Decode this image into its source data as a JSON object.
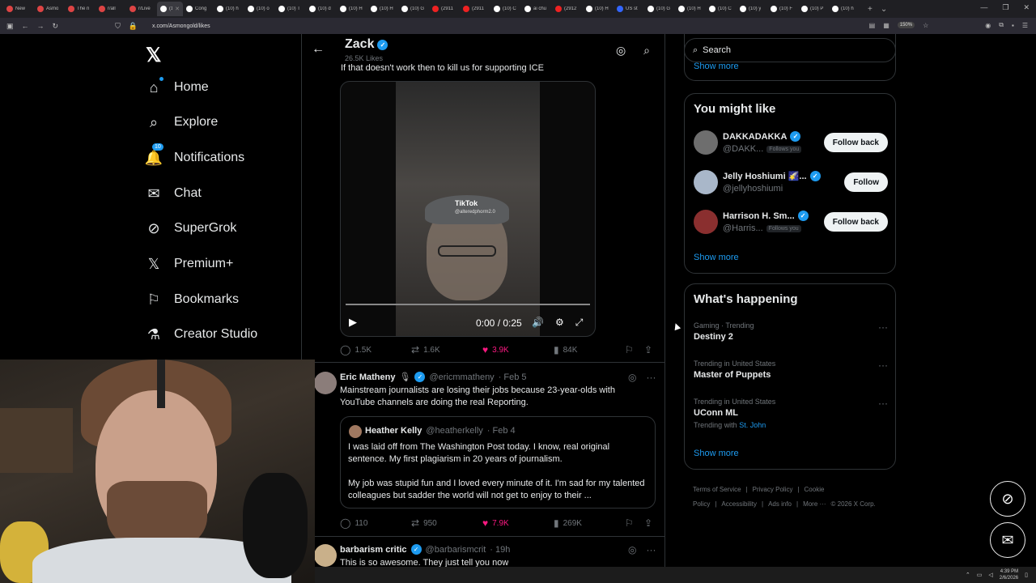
{
  "browser": {
    "tabs": [
      {
        "label": "New",
        "color": "#d44"
      },
      {
        "label": "Asmo",
        "color": "#d44"
      },
      {
        "label": "The n",
        "color": "#d44"
      },
      {
        "label": "r/all",
        "color": "#d44"
      },
      {
        "label": "r/Live",
        "color": "#d44"
      },
      {
        "label": "(1(",
        "color": "#fff"
      },
      {
        "label": "Cong",
        "color": "#fff"
      },
      {
        "label": "(10) h",
        "color": "#fff"
      },
      {
        "label": "(10) o",
        "color": "#fff"
      },
      {
        "label": "(10) T",
        "color": "#fff"
      },
      {
        "label": "(10) d",
        "color": "#fff"
      },
      {
        "label": "(10) H",
        "color": "#fff"
      },
      {
        "label": "(10) H",
        "color": "#fff"
      },
      {
        "label": "(10) G",
        "color": "#fff"
      },
      {
        "label": "(2911",
        "color": "#e22"
      },
      {
        "label": "(2911",
        "color": "#e22"
      },
      {
        "label": "(10) C",
        "color": "#fff"
      },
      {
        "label": "ai chu",
        "color": "#fff"
      },
      {
        "label": "(2912",
        "color": "#e22"
      },
      {
        "label": "(10) H",
        "color": "#fff"
      },
      {
        "label": "US st",
        "color": "#36f"
      },
      {
        "label": "(10) G",
        "color": "#fff"
      },
      {
        "label": "(10) H",
        "color": "#fff"
      },
      {
        "label": "(10) C",
        "color": "#fff"
      },
      {
        "label": "(10) y",
        "color": "#fff"
      },
      {
        "label": "(10) F",
        "color": "#fff"
      },
      {
        "label": "(10) P",
        "color": "#fff"
      },
      {
        "label": "(10) h",
        "color": "#fff"
      }
    ],
    "url": "x.com/Asmongold/likes",
    "zoom": "150%"
  },
  "nav": {
    "items": [
      {
        "label": "Home",
        "icon": "home-icon"
      },
      {
        "label": "Explore",
        "icon": "search-icon"
      },
      {
        "label": "Notifications",
        "icon": "bell-icon",
        "badge": "10"
      },
      {
        "label": "Chat",
        "icon": "mail-icon"
      },
      {
        "label": "SuperGrok",
        "icon": "grok-icon"
      },
      {
        "label": "Premium+",
        "icon": "x-icon"
      },
      {
        "label": "Bookmarks",
        "icon": "bookmark-icon"
      },
      {
        "label": "Creator Studio",
        "icon": "flask-icon"
      }
    ]
  },
  "header": {
    "name": "Zack",
    "likes": "26.5K Likes"
  },
  "tweet1": {
    "text": "If that doesn't work then to kill us for supporting ICE",
    "video": {
      "watermark": "TikTok",
      "watermark_handle": "@alteredphorm2.0",
      "time": "0:00 / 0:25",
      "progress": 0.0
    },
    "replies": "1.5K",
    "reposts": "1.6K",
    "likes": "3.9K",
    "views": "84K"
  },
  "tweet2": {
    "name": "Eric Matheny",
    "handle": "@ericmmatheny",
    "date": "· Feb 5",
    "text": "Mainstream journalists are losing their jobs because 23-year-olds with YouTube channels are doing the real Reporting.",
    "quote": {
      "name": "Heather Kelly",
      "handle": "@heatherkelly",
      "date": "· Feb 4",
      "text1": "I was laid off from The Washington Post today. I know, real original sentence. My first plagiarism in 20 years of journalism.",
      "text2": "My job was stupid fun and I loved every minute of it. I'm sad for my talented colleagues but sadder the world will not get to enjoy to their ..."
    },
    "replies": "110",
    "reposts": "950",
    "likes": "7.9K",
    "views": "269K"
  },
  "tweet3": {
    "name": "barbarism critic",
    "handle": "@barbarismcrit",
    "date": "· 19h",
    "text": "This is so awesome. They just tell you now"
  },
  "search": {
    "placeholder": "Search"
  },
  "top_card": {
    "show_more": "Show more"
  },
  "you_might_like": {
    "title": "You might like",
    "people": [
      {
        "name": "DAKKADAKKA",
        "handle": "@DAKK...",
        "follows_you": "Follows you",
        "button": "Follow back"
      },
      {
        "name": "Jelly Hoshiumi 🌠...",
        "handle": "@jellyhoshiumi",
        "follows_you": "",
        "button": "Follow"
      },
      {
        "name": "Harrison H. Sm...",
        "handle": "@Harris...",
        "follows_you": "Follows you",
        "button": "Follow back"
      }
    ],
    "show_more": "Show more"
  },
  "whats_happening": {
    "title": "What's happening",
    "trends": [
      {
        "meta": "Gaming · Trending",
        "topic": "Destiny 2",
        "with_label": "",
        "with_link": ""
      },
      {
        "meta": "Trending in United States",
        "topic": "Master of Puppets",
        "with_label": "",
        "with_link": ""
      },
      {
        "meta": "Trending in United States",
        "topic": "UConn ML",
        "with_label": "Trending with",
        "with_link": "St. John"
      }
    ],
    "show_more": "Show more"
  },
  "footer": {
    "links": [
      "Terms of Service",
      "|",
      "Privacy Policy",
      "|",
      "Cookie Policy",
      "|",
      "Accessibility",
      "|",
      "Ads info",
      "|",
      "More ···",
      "© 2026 X Corp."
    ]
  },
  "taskbar": {
    "time": "4:39 PM",
    "date": "2/6/2026"
  }
}
